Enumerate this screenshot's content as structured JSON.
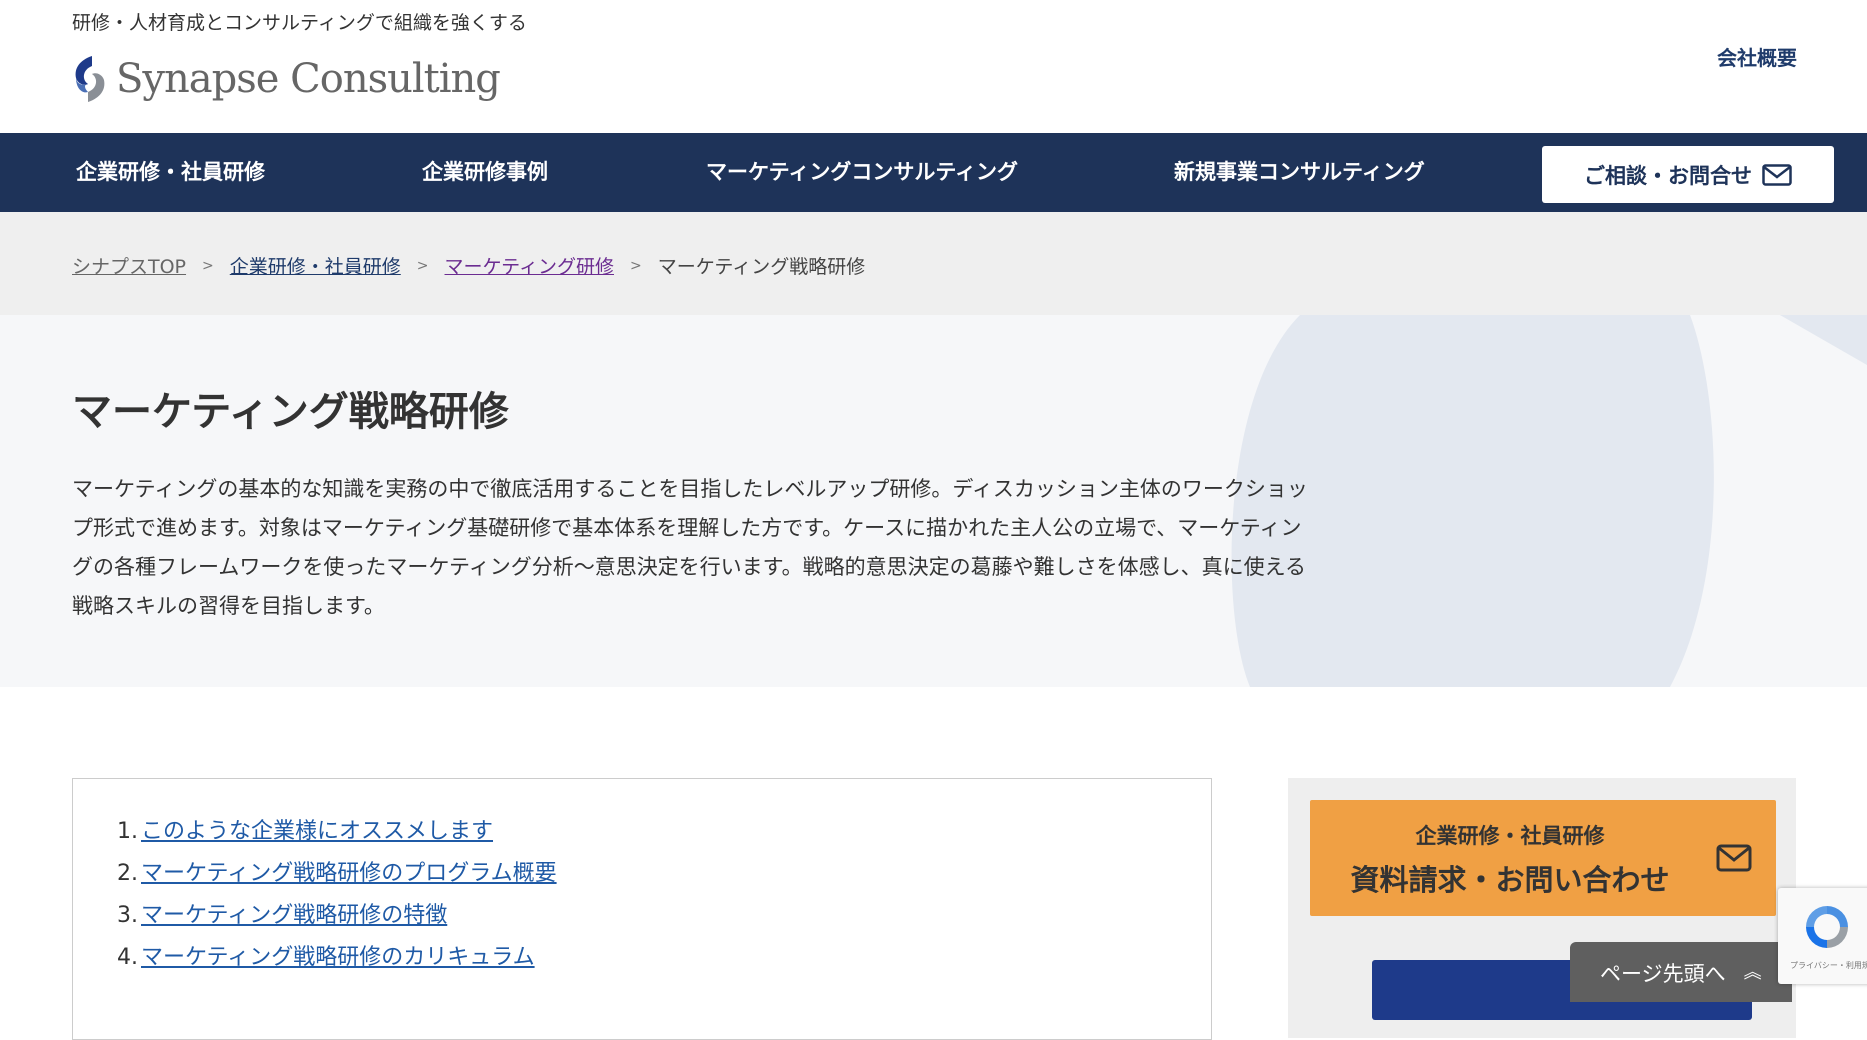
{
  "header": {
    "tagline": "研修・人材育成とコンサルティングで組織を強くする",
    "logo_text": "Synapse Consulting",
    "company_link": "会社概要"
  },
  "nav": {
    "items": [
      {
        "label": "企業研修・社員研修"
      },
      {
        "label": "企業研修事例"
      },
      {
        "label": "マーケティングコンサルティング"
      },
      {
        "label": "新規事業コンサルティング"
      }
    ],
    "cta": "ご相談・お問合せ"
  },
  "breadcrumb": {
    "items": [
      "シナプスTOP",
      "企業研修・社員研修",
      "マーケティング研修"
    ],
    "separator": ">",
    "current": "マーケティング戦略研修"
  },
  "hero": {
    "title": "マーケティング戦略研修",
    "description": "マーケティングの基本的な知識を実務の中で徹底活用することを目指したレベルアップ研修。ディスカッション主体のワークショップ形式で進めます。対象はマーケティング基礎研修で基本体系を理解した方です。ケースに描かれた主人公の立場で、マーケティングの各種フレームワークを使ったマーケティング分析～意思決定を行います。戦略的意思決定の葛藤や難しさを体感し、真に使える戦略スキルの習得を目指します。"
  },
  "toc": {
    "items": [
      {
        "num": "1.",
        "label": "このような企業様にオススメします"
      },
      {
        "num": "2.",
        "label": "マーケティング戦略研修のプログラム概要"
      },
      {
        "num": "3.",
        "label": "マーケティング戦略研修の特徴"
      },
      {
        "num": "4.",
        "label": "マーケティング戦略研修のカリキュラム"
      }
    ]
  },
  "sidebar": {
    "cta_small": "企業研修・社員研修",
    "cta_big": "資料請求・お問い合わせ"
  },
  "pagetop": {
    "label": "ページ先頭へ",
    "icon": "double-chevron-up-icon"
  },
  "recaptcha": {
    "text": "プライバシー・利用規約"
  },
  "colors": {
    "nav_bg": "#1e3359",
    "cta_orange": "#f0a044",
    "link_blue": "#1f5aa6",
    "breadcrumb_bg": "#efefef"
  }
}
